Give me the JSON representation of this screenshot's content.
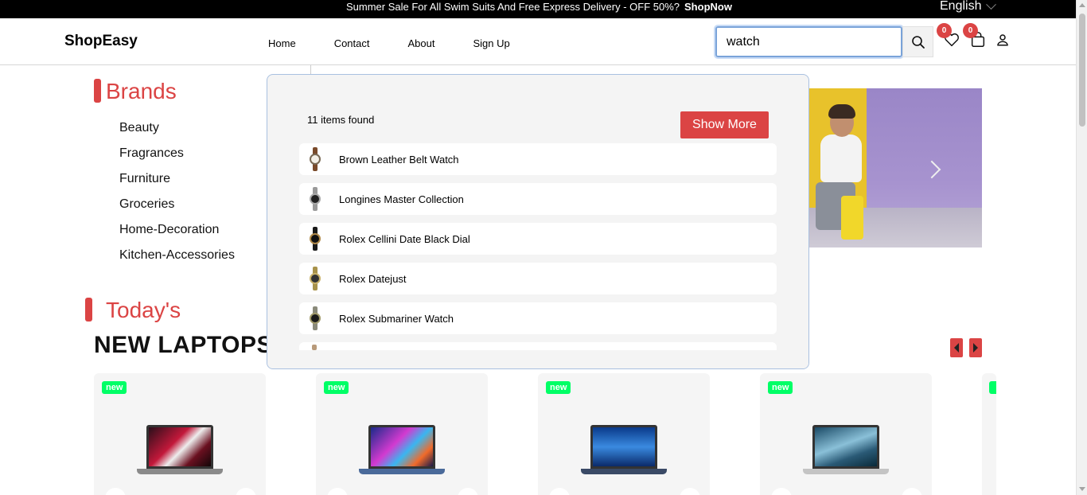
{
  "announcement": {
    "message": "Summer Sale For All Swim Suits And Free Express Delivery - OFF 50%?",
    "cta": "ShopNow",
    "language": "English"
  },
  "header": {
    "logo": "ShopEasy",
    "nav": [
      "Home",
      "Contact",
      "About",
      "Sign Up"
    ],
    "search_value": "watch",
    "wishlist_count": "0",
    "cart_count": "0"
  },
  "sidebar": {
    "title": "Brands",
    "items": [
      "Beauty",
      "Fragrances",
      "Furniture",
      "Groceries",
      "Home-Decoration",
      "Kitchen-Accessories"
    ]
  },
  "search_results": {
    "count_text": "11 items found",
    "show_more": "Show More",
    "items": [
      {
        "name": "Brown Leather Belt Watch"
      },
      {
        "name": "Longines Master Collection"
      },
      {
        "name": "Rolex Cellini Date Black Dial"
      },
      {
        "name": "Rolex Datejust"
      },
      {
        "name": "Rolex Submariner Watch"
      }
    ]
  },
  "section": {
    "label": "Today's",
    "title": "NEW LAPTOPS"
  },
  "products": [
    {
      "tag": "new"
    },
    {
      "tag": "new"
    },
    {
      "tag": "new"
    },
    {
      "tag": "new"
    }
  ],
  "colors": {
    "accent": "#db4444",
    "new_tag": "#00ff66"
  }
}
